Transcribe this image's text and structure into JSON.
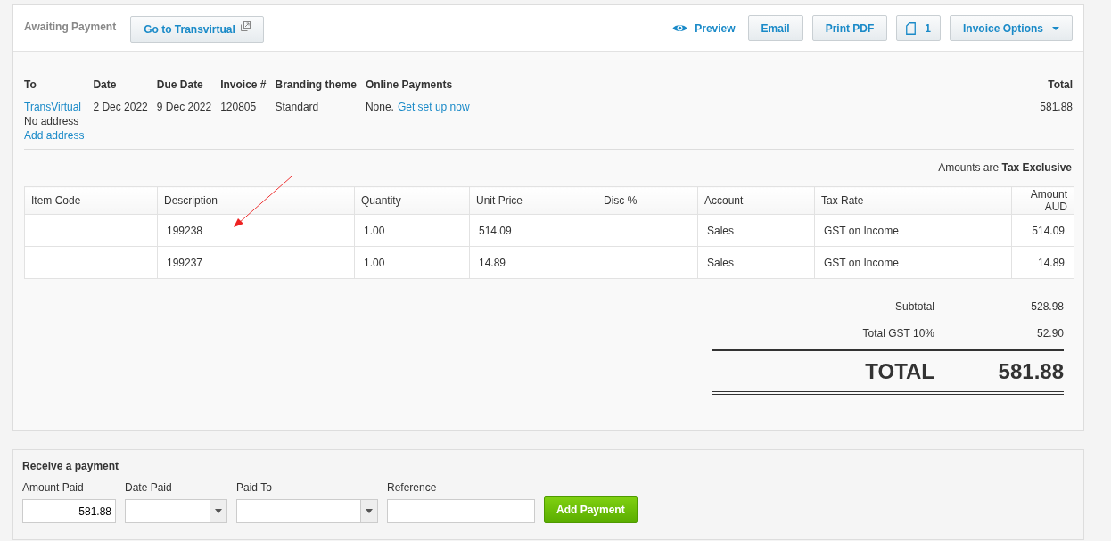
{
  "header": {
    "status": "Awaiting Payment",
    "go_button": "Go to Transvirtual",
    "preview": "Preview",
    "buttons": [
      "Email",
      "Print PDF"
    ],
    "copies": "1",
    "options": "Invoice Options"
  },
  "details": {
    "to": {
      "label": "To",
      "name": "TransVirtual",
      "address": "No address",
      "add_address": "Add address"
    },
    "fields": [
      {
        "label": "Date",
        "value": "2 Dec 2022"
      },
      {
        "label": "Due Date",
        "value": "9 Dec 2022"
      },
      {
        "label": "Invoice #",
        "value": "120805"
      },
      {
        "label": "Branding theme",
        "value": "Standard"
      }
    ],
    "online": {
      "label": "Online Payments",
      "value": "None.",
      "link": "Get set up now"
    },
    "total": {
      "label": "Total",
      "value": "581.88"
    }
  },
  "amounts_note": "Amounts are **Tax Exclusive**",
  "table": {
    "columns": [
      "Item Code",
      "Description",
      "Quantity",
      "Unit Price",
      "Disc %",
      "Account",
      "Tax Rate",
      "Amount AUD"
    ],
    "rows": [
      [
        "",
        "199238",
        "1.00",
        "514.09",
        "",
        "Sales",
        "GST on Income",
        "514.09"
      ],
      [
        "",
        "199237",
        "1.00",
        "14.89",
        "",
        "Sales",
        "GST on Income",
        "14.89"
      ]
    ]
  },
  "totals": {
    "subtotal": {
      "label": "Subtotal",
      "value": "528.98"
    },
    "gst": {
      "label": "Total GST  10%",
      "value": "52.90"
    },
    "total": {
      "label": "TOTAL",
      "value": "581.88"
    }
  },
  "payment": {
    "title": "Receive a payment",
    "fields": [
      {
        "kind": "input",
        "label": "Amount Paid",
        "value": "581.88"
      },
      {
        "kind": "select",
        "label": "Date Paid"
      },
      {
        "kind": "select",
        "label": "Paid To"
      },
      {
        "kind": "text",
        "label": "Reference"
      }
    ],
    "button": "Add Payment"
  }
}
